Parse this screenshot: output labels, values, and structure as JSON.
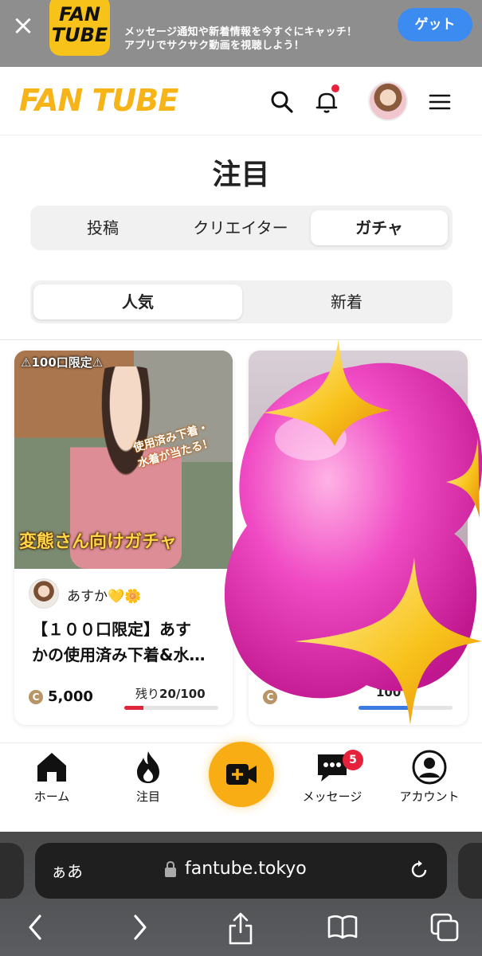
{
  "banner": {
    "close_label": "×",
    "app_logo_line1": "FAN",
    "app_logo_line2": "TUBE",
    "message_line1": "メッセージ通知や新着情報を今すぐにキャッチ！",
    "message_line2": "アプリでサクサク動画を視聴しよう！",
    "get_label": "ゲット"
  },
  "header": {
    "logo": "FAN TUBE",
    "icons": [
      "search-icon",
      "bell-icon",
      "avatar",
      "menu-icon"
    ],
    "notification_dot_color": "#e8233c"
  },
  "page_title": "注目",
  "tabs_primary": {
    "items": [
      "投稿",
      "クリエイター",
      "ガチャ"
    ],
    "selected": "ガチャ"
  },
  "tabs_secondary": {
    "items": [
      "人気",
      "新着"
    ],
    "selected": "人気"
  },
  "cards": [
    {
      "badge": "⚠100口限定⚠",
      "overlay_line1": "使用済み下着・",
      "overlay_line2": "水着が当たる！",
      "overlay_main": "変態さん向けガチャ",
      "creator_name": "あすか💛🌼",
      "title_line1": "【１００口限定】あす",
      "title_line2": "かの使用済み下着&水…",
      "coin_symbol": "C",
      "price": "5,000",
      "remaining_label": "残り",
      "remaining_value": "20/100",
      "remaining_fraction": 0.2
    },
    {
      "price_partial": "100",
      "coin_symbol": "C",
      "remaining_fraction": 0.55
    }
  ],
  "bottom_nav": {
    "items": [
      {
        "label": "ホーム",
        "icon": "home-icon"
      },
      {
        "label": "注目",
        "icon": "flame-icon"
      },
      {
        "label": "",
        "icon": "video-add-icon"
      },
      {
        "label": "メッセージ",
        "icon": "chat-icon",
        "badge": "5"
      },
      {
        "label": "アカウント",
        "icon": "account-icon"
      }
    ],
    "accent_color": "#f8ad15"
  },
  "browser": {
    "aa_label": "ぁあ",
    "url": "fantube.tokyo"
  },
  "colors": {
    "brand": "#f7b419",
    "progress_red": "#e0263a",
    "progress_blue": "#3b7ae0"
  }
}
